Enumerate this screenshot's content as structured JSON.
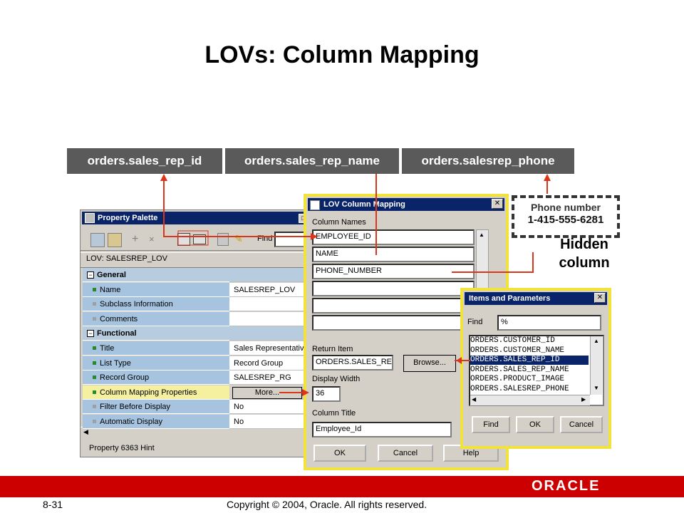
{
  "slide": {
    "title": "LOVs: Column Mapping",
    "page_number": "8-31",
    "copyright": "Copyright © 2004, Oracle.  All rights reserved.",
    "logo": "ORACLE"
  },
  "tags": [
    "orders.sales_rep_id",
    "orders.sales_rep_name",
    "orders.salesrep_phone"
  ],
  "hint": {
    "line1": "Phone number",
    "line2": "1-415-555-6281",
    "hidden_line1": "Hidden",
    "hidden_line2": "column"
  },
  "property_palette": {
    "title": "Property Palette",
    "find_label": "Find",
    "lov_name": "LOV: SALESREP_LOV",
    "status": "Property 6363 Hint",
    "rows": [
      {
        "label": "General",
        "value": "",
        "type": "group"
      },
      {
        "label": "Name",
        "value": "SALESREP_LOV",
        "type": "prop"
      },
      {
        "label": "Subclass Information",
        "value": "",
        "type": "prop"
      },
      {
        "label": "Comments",
        "value": "",
        "type": "prop"
      },
      {
        "label": "Functional",
        "value": "",
        "type": "group"
      },
      {
        "label": "Title",
        "value": "Sales Representativ",
        "type": "prop"
      },
      {
        "label": "List Type",
        "value": "Record Group",
        "type": "prop"
      },
      {
        "label": "Record Group",
        "value": "SALESREP_RG",
        "type": "prop"
      },
      {
        "label": "Column Mapping Properties",
        "value": "More...",
        "type": "selected"
      },
      {
        "label": "Filter Before Display",
        "value": "No",
        "type": "prop"
      },
      {
        "label": "Automatic Display",
        "value": "No",
        "type": "prop"
      }
    ]
  },
  "lov_dialog": {
    "title": "LOV Column Mapping",
    "column_names_label": "Column Names",
    "columns": [
      "EMPLOYEE_ID",
      "NAME",
      "PHONE_NUMBER",
      "",
      "",
      ""
    ],
    "return_item_label": "Return Item",
    "return_item_value": "ORDERS.SALES_RE",
    "browse_label": "Browse...",
    "display_width_label": "Display Width",
    "display_width_value": "36",
    "column_title_label": "Column Title",
    "column_title_value": "Employee_Id",
    "ok_label": "OK",
    "cancel_label": "Cancel",
    "help_label": "Help"
  },
  "items_dialog": {
    "title": "Items and Parameters",
    "find_label": "Find",
    "find_value": "%",
    "items": [
      "ORDERS.CUSTOMER_ID",
      "ORDERS.CUSTOMER_NAME",
      "ORDERS.SALES_REP_ID",
      "ORDERS.SALES_REP_NAME",
      "ORDERS.PRODUCT_IMAGE",
      "ORDERS.SALESREP_PHONE"
    ],
    "selected_index": 2,
    "find_button": "Find",
    "ok_label": "OK",
    "cancel_label": "Cancel"
  },
  "colors": {
    "tag_bg": "#5a5a5a",
    "arrow": "#d9361b",
    "oracle_red": "#cc0000",
    "highlight_border": "#f2e23c",
    "titlebar": "#0a246a"
  }
}
